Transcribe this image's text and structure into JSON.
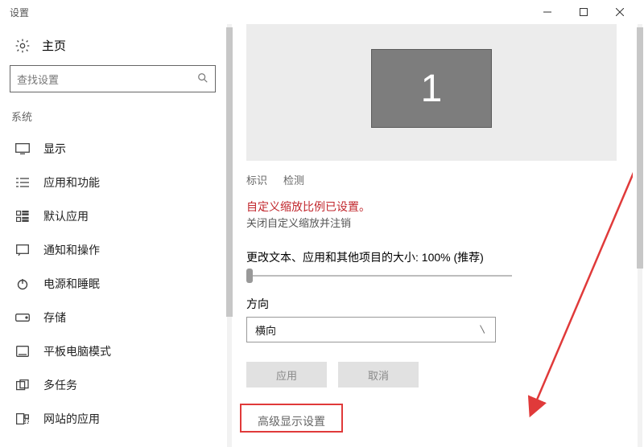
{
  "window": {
    "title": "设置"
  },
  "sidebar": {
    "home_label": "主页",
    "search_placeholder": "查找设置",
    "section_label": "系统",
    "items": [
      {
        "label": "显示"
      },
      {
        "label": "应用和功能"
      },
      {
        "label": "默认应用"
      },
      {
        "label": "通知和操作"
      },
      {
        "label": "电源和睡眠"
      },
      {
        "label": "存储"
      },
      {
        "label": "平板电脑模式"
      },
      {
        "label": "多任务"
      },
      {
        "label": "网站的应用"
      }
    ]
  },
  "main": {
    "monitor_number": "1",
    "identify_label": "标识",
    "detect_label": "检测",
    "warning_text": "自定义缩放比例已设置。",
    "signout_note": "关闭自定义缩放并注销",
    "scale_label": "更改文本、应用和其他项目的大小: 100% (推荐)",
    "orientation_label": "方向",
    "orientation_value": "横向",
    "apply_label": "应用",
    "cancel_label": "取消",
    "advanced_label": "高级显示设置"
  }
}
